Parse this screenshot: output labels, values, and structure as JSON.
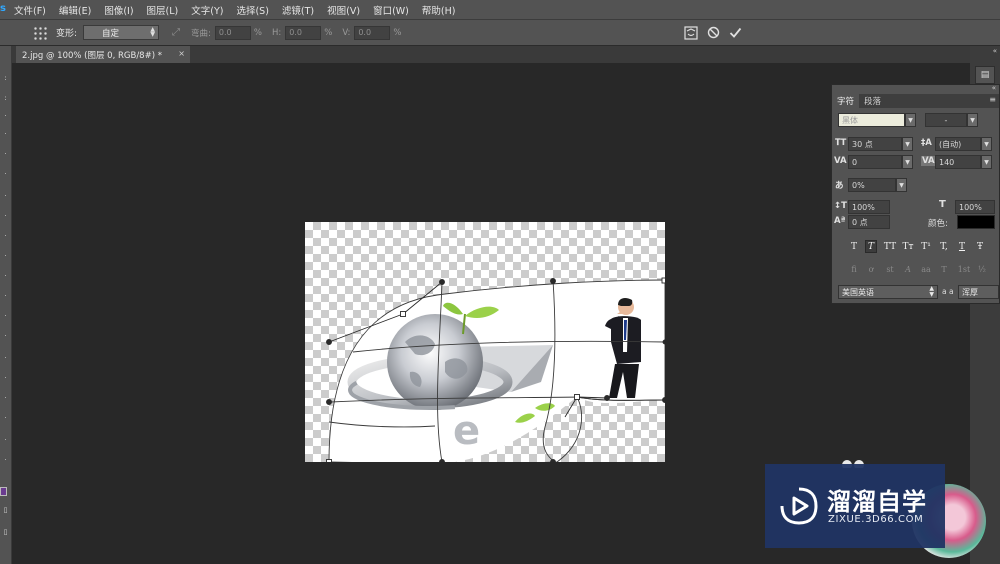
{
  "menubar": {
    "items": [
      "文件(F)",
      "编辑(E)",
      "图像(I)",
      "图层(L)",
      "文字(Y)",
      "选择(S)",
      "滤镜(T)",
      "视图(V)",
      "窗口(W)",
      "帮助(H)"
    ]
  },
  "options": {
    "warp_label": "变形:",
    "warp_value": "自定",
    "bend_label": "弯曲:",
    "bend_value": "0.0",
    "bend_unit": "%",
    "h_label": "H:",
    "h_value": "0.0",
    "h_unit": "%",
    "v_label": "V:",
    "v_value": "0.0",
    "v_unit": "%"
  },
  "document": {
    "tab_title": "2.jpg @ 100% (图层 0, RGB/8#) *",
    "close_glyph": "×"
  },
  "char_panel": {
    "tabs": [
      "字符",
      "段落"
    ],
    "font_family": "黑体",
    "font_style": "-",
    "font_size": "30 点",
    "leading": "(自动)",
    "kerning": "0",
    "tracking": "140",
    "tsume": "0%",
    "vertical_scale": "100%",
    "horizontal_scale": "100%",
    "baseline_shift": "0 点",
    "color_label": "颜色:",
    "text_color": "#000000",
    "style_buttons": [
      "T",
      "T",
      "TT",
      "Tт",
      "T¹",
      "T,",
      "T",
      "Ŧ"
    ],
    "opentype_buttons": [
      "fi",
      "ơ",
      "st",
      "A",
      "aa",
      "T",
      "1st",
      "½"
    ],
    "language": "美国英语",
    "aa_label": "a a",
    "antialias": "浑厚"
  },
  "watermark": {
    "title": "溜溜自学",
    "url": "ZIXUE.3D66.COM"
  },
  "colors": {
    "ui_panel": "#535353",
    "ui_dark": "#282828",
    "watermark_bg": "#203463",
    "checker": "#cccccc"
  }
}
